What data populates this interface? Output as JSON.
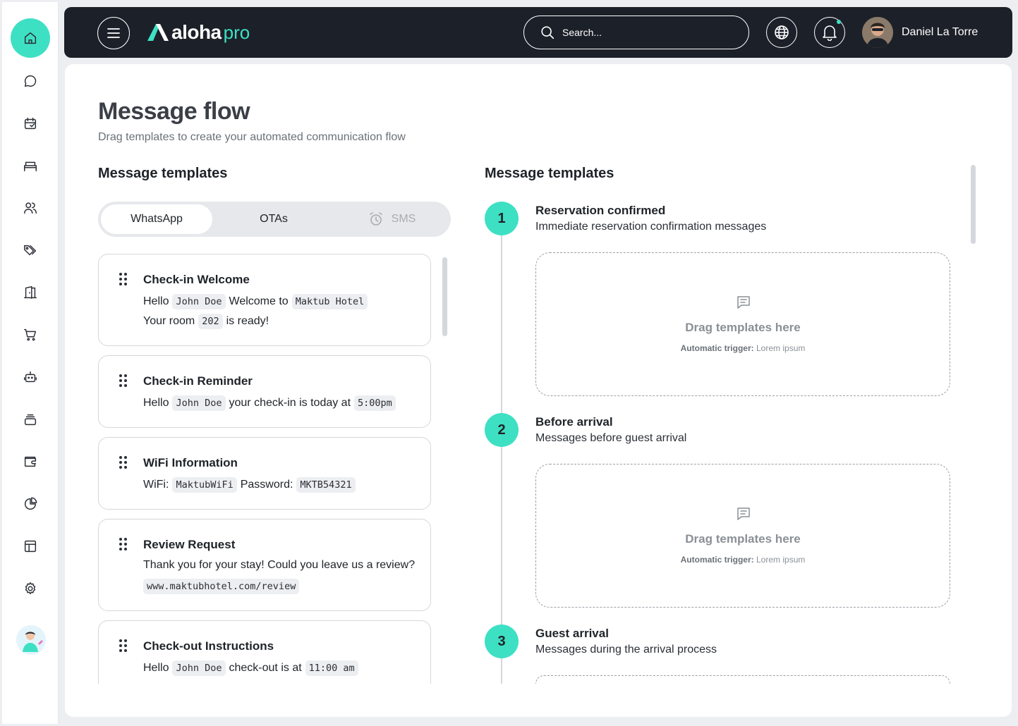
{
  "topbar": {
    "logo_text": "aloha",
    "logo_suffix": "pro",
    "search_placeholder": "Search...",
    "user_name": "Daniel La Torre"
  },
  "rail": {
    "items": [
      "home-icon",
      "chat-icon",
      "calendar-icon",
      "bed-icon",
      "users-icon",
      "tags-icon",
      "door-icon",
      "cart-icon",
      "robot-icon",
      "layers-icon",
      "wallet-icon",
      "pie-chart-icon",
      "layout-icon",
      "gear-icon"
    ]
  },
  "page": {
    "title": "Message flow",
    "subtitle": "Drag templates to create your automated communication flow"
  },
  "left": {
    "heading": "Message templates",
    "tabs": [
      {
        "label": "WhatsApp",
        "active": true
      },
      {
        "label": "OTAs",
        "active": false
      },
      {
        "label": "SMS",
        "active": false
      }
    ],
    "templates": [
      {
        "title": "Check-in Welcome",
        "l1_a": "Hello",
        "l1_chip1": "John Doe",
        "l1_b": "Welcome to",
        "l1_chip2": "Maktub Hotel",
        "l2_a": "Your room",
        "l2_chip1": "202",
        "l2_b": "is ready!"
      },
      {
        "title": "Check-in Reminder",
        "l1_a": "Hello",
        "l1_chip1": "John Doe",
        "l1_b": "your check-in is today at",
        "l1_chip2": "5:00pm"
      },
      {
        "title": "WiFi Information",
        "l1_a": "WiFi:",
        "l1_chip1": "MaktubWiFi",
        "l1_b": "Password:",
        "l1_chip2": "MKTB54321"
      },
      {
        "title": "Review Request",
        "l1_a": "Thank you for your stay! Could you leave us a review?",
        "l2_chip1": "www.maktubhotel.com/review"
      },
      {
        "title": "Check-out Instructions",
        "l1_a": "Hello",
        "l1_chip1": "John Doe",
        "l1_b": "check-out is at",
        "l1_chip2": "11:00 am"
      }
    ]
  },
  "right": {
    "heading": "Message templates",
    "steps": [
      {
        "num": "1",
        "title": "Reservation confirmed",
        "desc": "Immediate reservation confirmation messages",
        "drop_text": "Drag templates here",
        "trigger_label": "Automatic trigger:",
        "trigger_value": "Lorem ipsum"
      },
      {
        "num": "2",
        "title": "Before arrival",
        "desc": "Messages before guest arrival",
        "drop_text": "Drag templates here",
        "trigger_label": "Automatic trigger:",
        "trigger_value": "Lorem ipsum"
      },
      {
        "num": "3",
        "title": "Guest arrival",
        "desc": "Messages during the arrival process"
      }
    ]
  },
  "colors": {
    "accent": "#3ee0c4",
    "topbar": "#1c2028"
  }
}
